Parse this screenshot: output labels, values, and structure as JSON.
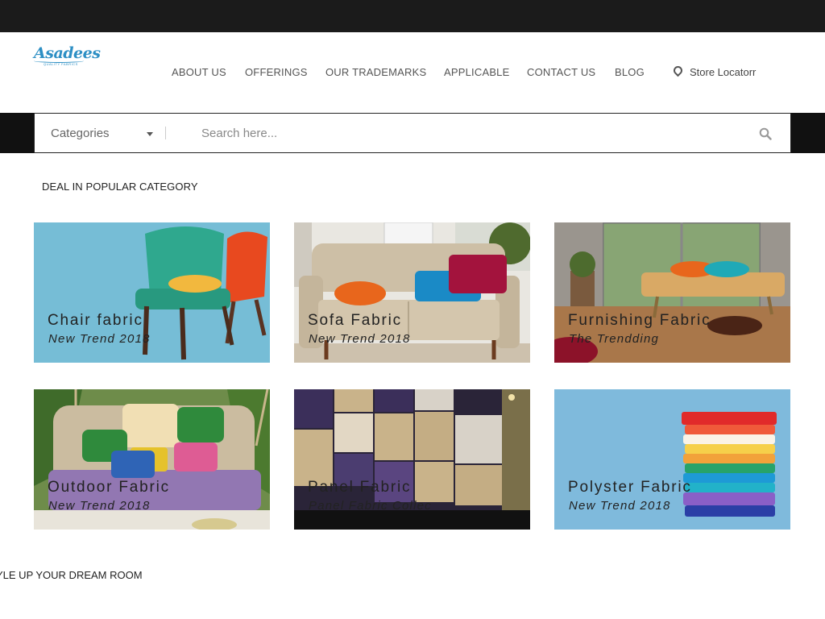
{
  "brand": {
    "logo_text": "Asadees",
    "tagline": "QUALITY FABRICS"
  },
  "nav": {
    "items": [
      {
        "label": "ABOUT US"
      },
      {
        "label": "OFFERINGS"
      },
      {
        "label": "OUR TRADEMARKS"
      },
      {
        "label": "APPLICABLE"
      },
      {
        "label": "CONTACT US"
      },
      {
        "label": "BLOG"
      }
    ],
    "store_locator": "Store Locatorr"
  },
  "search": {
    "category_label": "Categories",
    "placeholder": "Search here..."
  },
  "section": {
    "heading": "DEAL IN POPULAR CATEGORY"
  },
  "categories": [
    {
      "title": "Chair fabric",
      "subtitle": "New Trend 2018"
    },
    {
      "title": "Sofa Fabric",
      "subtitle": "New Trend 2018"
    },
    {
      "title": "Furnishing Fabric",
      "subtitle": "The Trendding"
    },
    {
      "title": "Outdoor Fabric",
      "subtitle": "New Trend 2018"
    },
    {
      "title": "Panel Fabric",
      "subtitle": "Panel Fabric Collec"
    },
    {
      "title": "Polyster Fabric",
      "subtitle": "New Trend 2018"
    }
  ],
  "footer": {
    "heading": "YLE UP YOUR DREAM ROOM"
  },
  "colors": {
    "topbar": "#1b1b1b",
    "logo": "#2d8fc4",
    "card_blue": "#76bdd6"
  }
}
